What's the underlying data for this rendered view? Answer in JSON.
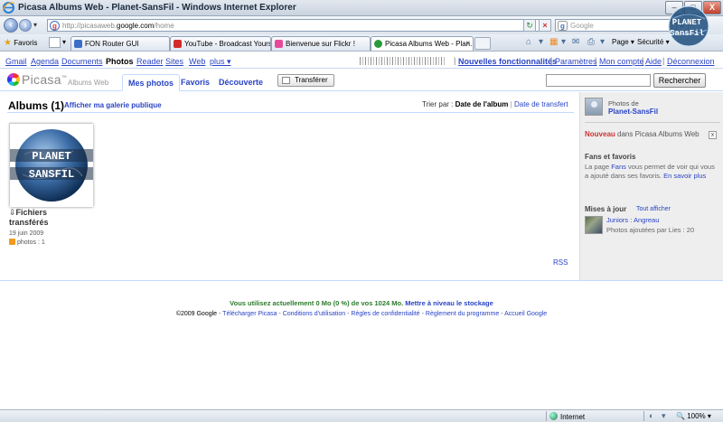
{
  "window": {
    "title": "Picasa Albums Web - Planet-SansFil - Windows Internet Explorer",
    "min_label": "–",
    "max_label": "□",
    "close_label": "X"
  },
  "addressbar": {
    "url_prefix": "http://picasaweb.",
    "url_domain": "google.com",
    "url_suffix": "/home",
    "search_placeholder": "Google"
  },
  "favorites": {
    "label": "Favoris"
  },
  "tabs": [
    {
      "label": "FON Router GUI",
      "color": "#3a6fc4"
    },
    {
      "label": "YouTube - Broadcast Yourself.",
      "color": "#d32b2b"
    },
    {
      "label": "Bienvenue sur Flickr  !",
      "color": "#e84a9a"
    },
    {
      "label": "Picasa Albums Web - Plan...",
      "color": "#2b9a3c",
      "close": "x"
    }
  ],
  "commandbar": {
    "page": "Page",
    "security": "Sécurité"
  },
  "gbar": {
    "links": [
      "Gmail",
      "Agenda",
      "Documents",
      "Photos",
      "Reader",
      "Sites",
      "Web",
      "plus ▾"
    ],
    "current": "Photos",
    "right_links": [
      "Nouvelles fonctionnalités",
      "Paramètres",
      "Mon compte",
      "Aide",
      "Déconnexion"
    ]
  },
  "picasa": {
    "logo": "Picasa",
    "logo_tm": "™",
    "subtitle": "Albums Web",
    "tabs": [
      "Mes photos",
      "Favoris",
      "Découverte"
    ],
    "active_tab": "Mes photos",
    "upload": "Transférer",
    "search_button": "Rechercher"
  },
  "main": {
    "albums_title": "Albums (1)",
    "public_link": "Afficher ma galerie publique",
    "sort_label": "Trier par :",
    "sort_selected": "Date de l'album",
    "sort_option": "Date de transfert",
    "album": {
      "arrow": "⇩",
      "name": "Fichiers transférés",
      "date": "19 juin 2009",
      "count": "photos : 1",
      "cover_text_1": "PLANET",
      "cover_text_2": "SANSFIL"
    },
    "rss": "RSS"
  },
  "sidebar": {
    "photos_of": "Photos de",
    "user": "Planet-SansFil",
    "new_label": "Nouveau",
    "new_text": " dans Picasa Albums Web",
    "fans_title": "Fans et favoris",
    "fans_text_1": "La page ",
    "fans_link": "Fans",
    "fans_text_2": " vous permet de voir qui vous a ajouté dans ses favoris. ",
    "fans_more": "En savoir plus",
    "updates_title": "Mises à jour",
    "show_all": "Tout afficher",
    "update_who": "Juniors : Angreau",
    "update_what": "Photos ajoutées par Lies  : 20"
  },
  "footer": {
    "storage_text": "Vous utilisez actuellement 0 Mo (0 %) de vos 1024 Mo.",
    "storage_link": "Mettre à niveau le stockage",
    "copyright": "©2009 Google",
    "links": [
      "Télécharger Picasa",
      "Conditions d'utilisation",
      "Règles de confidentialité",
      "Règlement du programme",
      "Accueil Google"
    ]
  },
  "statusbar": {
    "zone": "Internet",
    "zoom": "100%"
  },
  "brand": {
    "line1": "PLANET",
    "line2": "SansFil"
  },
  "colors": {
    "link": "#2a44c4",
    "accent_green": "#2b7a2b",
    "new_red": "#cc3333"
  }
}
